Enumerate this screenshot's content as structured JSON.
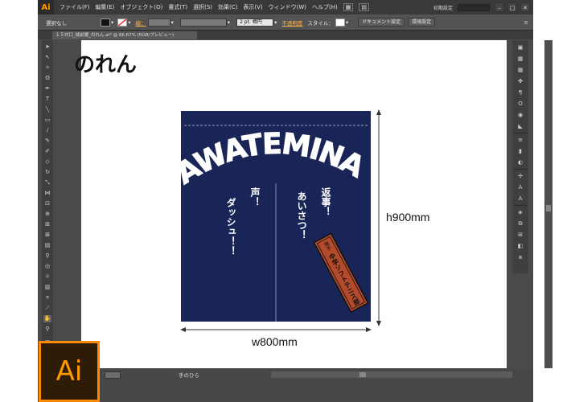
{
  "menu": {
    "app_badge": "Ai",
    "items": [
      "ファイル(F)",
      "編集(E)",
      "オブジェクト(O)",
      "書式(T)",
      "選択(S)",
      "効果(C)",
      "表示(V)",
      "ウィンドウ(W)",
      "ヘルプ(H)"
    ],
    "workspace": "初期設定"
  },
  "control": {
    "selection_status": "選択なし",
    "stroke_label": "線：",
    "brush_size": "2 pt. 楕円",
    "opacity_link": "不透明度",
    "style_label": "スタイル：",
    "document_setup": "ドキュメント設定",
    "preferences": "環境設定"
  },
  "doc_tab": {
    "title": "１５対口_縫前暖_のれん.ai* @ 66.67% (RGB/プレビュー)"
  },
  "status": {
    "tool_name": "手のひら"
  },
  "artboard": {
    "title": "のれん",
    "banner_text": "NAWATEMINAMI",
    "left_text": [
      "声！",
      "ダッシュ！！"
    ],
    "right_text": [
      "返事！",
      "あいさつ！"
    ],
    "stamp_top": "縄手",
    "stamp_text": "中学ソフトテニス部",
    "height_label": "h900mm",
    "width_label": "w800mm"
  },
  "colors": {
    "noren_navy": "#1a2557",
    "stamp_red": "#b24a2b",
    "ai_orange": "#ff9a00",
    "ai_dark": "#2f1c06"
  },
  "logo": {
    "text": "Ai"
  }
}
